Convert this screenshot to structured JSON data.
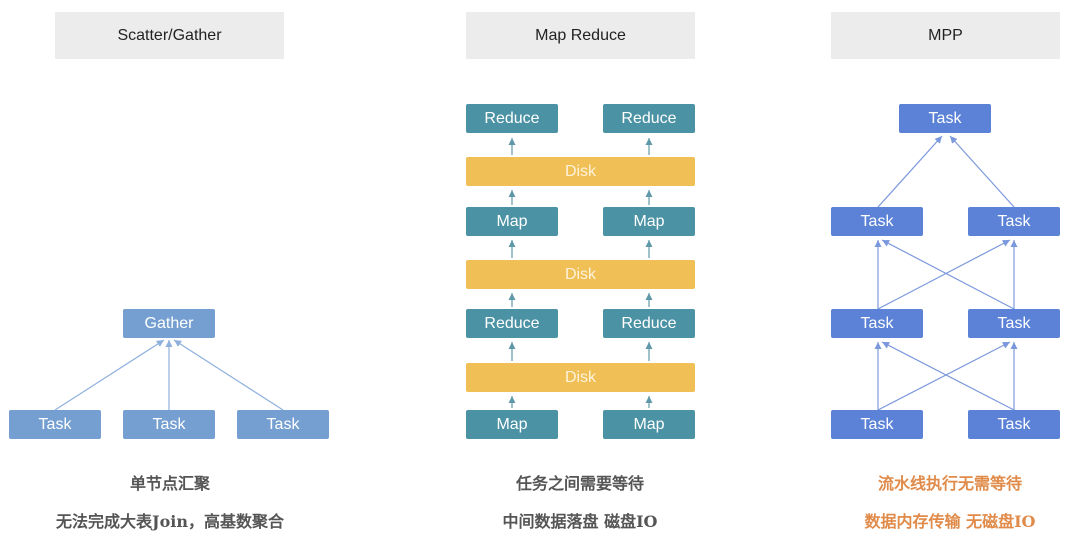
{
  "columns": [
    {
      "title": "Scatter/Gather",
      "nodes": {
        "gather": "Gather",
        "task1": "Task",
        "task2": "Task",
        "task3": "Task"
      },
      "caption": [
        "单节点汇聚",
        "无法完成大表Join，高基数聚合"
      ]
    },
    {
      "title": "Map Reduce",
      "nodes": {
        "reduce_top_left": "Reduce",
        "reduce_top_right": "Reduce",
        "disk1": "Disk",
        "map_mid_left": "Map",
        "map_mid_right": "Map",
        "disk2": "Disk",
        "reduce_mid_left": "Reduce",
        "reduce_mid_right": "Reduce",
        "disk3": "Disk",
        "map_bottom_left": "Map",
        "map_bottom_right": "Map"
      },
      "caption": [
        "任务之间需要等待",
        "中间数据落盘 磁盘IO"
      ]
    },
    {
      "title": "MPP",
      "nodes": {
        "task_top": "Task",
        "task_l2_left": "Task",
        "task_l2_right": "Task",
        "task_l3_left": "Task",
        "task_l3_right": "Task",
        "task_l4_left": "Task",
        "task_l4_right": "Task"
      },
      "caption": [
        "流水线执行无需等待",
        "数据内存传输 无磁盘IO"
      ]
    }
  ],
  "colors": {
    "scatter_gather_node": "#759fd0",
    "map_reduce_node": "#4b92a4",
    "disk": "#f0bf55",
    "mpp_node": "#5b82d6",
    "header_bg": "#ececec",
    "caption_gray": "#555555",
    "caption_orange": "#e08b4a"
  }
}
